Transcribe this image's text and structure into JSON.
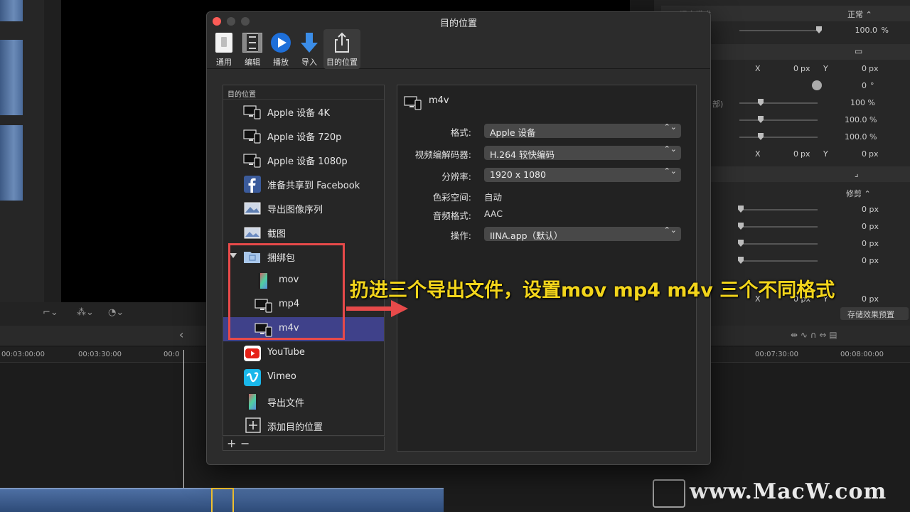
{
  "dialog": {
    "title": "目的位置",
    "toolbar": [
      {
        "label": "通用",
        "icon": "general-icon"
      },
      {
        "label": "编辑",
        "icon": "film-edit-icon"
      },
      {
        "label": "播放",
        "icon": "play-icon"
      },
      {
        "label": "导入",
        "icon": "import-arrow-icon"
      },
      {
        "label": "目的位置",
        "icon": "share-icon"
      }
    ],
    "list_header": "目的位置",
    "destinations": [
      {
        "label": "Apple 设备 4K",
        "icon": "apple-devices-icon"
      },
      {
        "label": "Apple 设备 720p",
        "icon": "apple-devices-icon"
      },
      {
        "label": "Apple 设备 1080p",
        "icon": "apple-devices-icon"
      },
      {
        "label": "准备共享到 Facebook",
        "icon": "facebook-icon"
      },
      {
        "label": "导出图像序列",
        "icon": "image-sequence-icon"
      },
      {
        "label": "截图",
        "icon": "screenshot-icon"
      },
      {
        "label": "捆绑包",
        "icon": "bundle-folder-icon"
      },
      {
        "label": "mov",
        "icon": "film-file-icon"
      },
      {
        "label": "mp4",
        "icon": "apple-devices-icon"
      },
      {
        "label": "m4v",
        "icon": "apple-devices-icon"
      },
      {
        "label": "YouTube",
        "icon": "youtube-icon"
      },
      {
        "label": "Vimeo",
        "icon": "vimeo-icon"
      },
      {
        "label": "导出文件",
        "icon": "film-file-icon"
      },
      {
        "label": "添加目的位置",
        "icon": "add-box-icon"
      }
    ],
    "footer": {
      "add": "+",
      "remove": "−"
    },
    "detail": {
      "name": "m4v",
      "format_label": "格式:",
      "format_value": "Apple 设备",
      "codec_label": "视频编解码器:",
      "codec_value": "H.264 较快编码",
      "resolution_label": "分辨率:",
      "resolution_value": "1920 x 1080",
      "colorspace_label": "色彩空间:",
      "colorspace_value": "自动",
      "audio_label": "音频格式:",
      "audio_value": "AAC",
      "action_label": "操作:",
      "action_value": "IINA.app（默认）",
      "popup_arrows": "⌃⌄"
    }
  },
  "annotation": {
    "text": "扔进三个导出文件，设置mov mp4 m4v 三个不同格式",
    "color": "#f3d51b",
    "box_color": "#e74a4a"
  },
  "inspector": {
    "blend_label": "混合模式",
    "blend_value": "正常 ⌃",
    "opacity_value": "100.0",
    "opacity_unit": "%",
    "pos_x_label": "X",
    "pos_x_value": "0",
    "pos_x_unit": "px",
    "pos_y_label": "Y",
    "pos_y_value": "0",
    "pos_y_unit": "px",
    "rotation_value": "0",
    "rotation_unit": "°",
    "scale_label": "部)",
    "scale_all": "100 %",
    "scale_x": "100.0 %",
    "scale_y": "100.0 %",
    "anchor_x_label": "X",
    "anchor_x_value": "0",
    "anchor_x_unit": "px",
    "anchor_y_label": "Y",
    "anchor_y_value": "0",
    "anchor_y_unit": "px",
    "crop_value": "修剪 ⌃",
    "crop_rows": [
      "0 px",
      "0 px",
      "0 px",
      "0 px"
    ],
    "dist_x_label": "X",
    "dist_x_value": "0 px",
    "dist_y_label": "Y",
    "dist_y_value": "0 px",
    "save_preset": "存储效果预置"
  },
  "timeline": {
    "ruler": [
      "00:03:00:00",
      "00:03:30:00",
      "00:0",
      "00:07:30:00",
      "00:08:00:00"
    ],
    "back_arrow": "‹"
  },
  "watermark": "www.MacW.com",
  "colors": {
    "selection": "#3f418a",
    "dialog_bg": "#2c2c2c",
    "close_button": "#fc5c57"
  }
}
